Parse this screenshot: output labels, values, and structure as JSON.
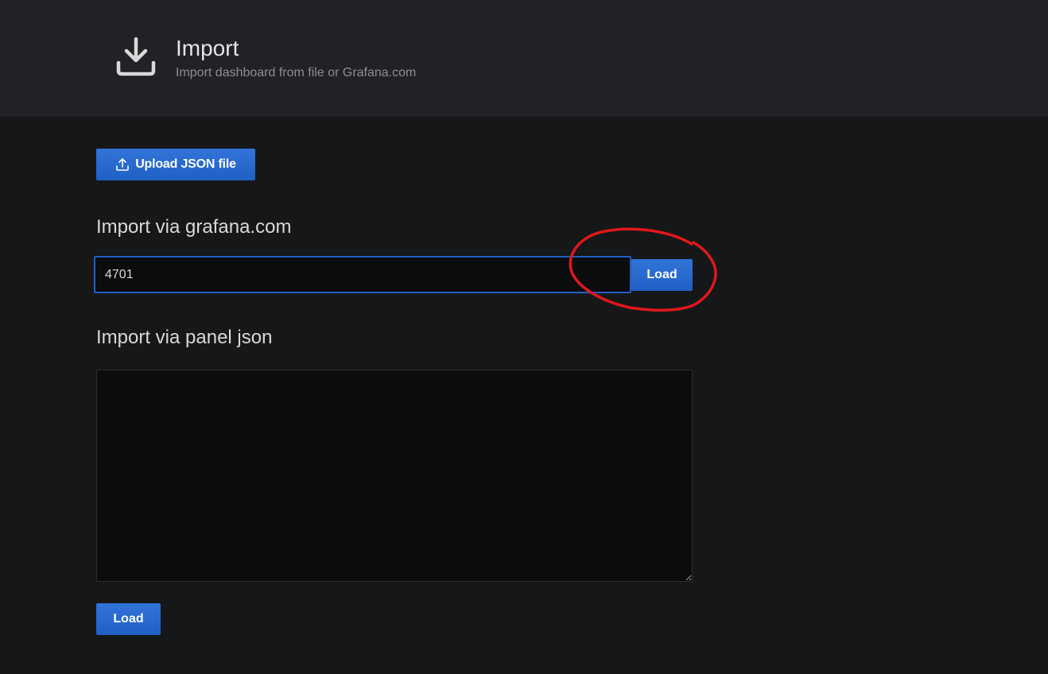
{
  "header": {
    "icon": "download-icon",
    "title": "Import",
    "subtitle": "Import dashboard from file or Grafana.com"
  },
  "upload": {
    "icon": "upload-icon",
    "label": "Upload JSON file"
  },
  "grafana_com": {
    "title": "Import via grafana.com",
    "input_value": "4701",
    "load_label": "Load"
  },
  "panel_json": {
    "title": "Import via panel json",
    "textarea_value": "",
    "load_label": "Load"
  },
  "annotation": {
    "type": "red-hand-drawn-circle",
    "color": "#e0181c",
    "target": "grafana_com.load_label"
  },
  "colors": {
    "primary_button": "#1f60c4",
    "page_background": "#161719",
    "header_background": "#202226",
    "input_background": "#0b0c0e"
  }
}
